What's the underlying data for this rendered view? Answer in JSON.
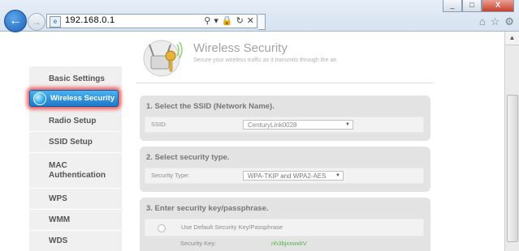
{
  "browser": {
    "url": "192.168.0.1",
    "window_buttons": [
      "_",
      "□",
      "X"
    ]
  },
  "header": {
    "title": "Wireless Security",
    "subtitle": "Secure your wireless traffic as it transmits through the air."
  },
  "sidebar": {
    "items": [
      {
        "label": "Basic Settings"
      },
      {
        "label": "Wireless Security",
        "active": true
      },
      {
        "label": "Radio Setup"
      },
      {
        "label": "SSID Setup"
      },
      {
        "label": "MAC Authentication"
      },
      {
        "label": "WPS"
      },
      {
        "label": "WMM"
      },
      {
        "label": "WDS"
      }
    ]
  },
  "section1": {
    "heading": "1. Select the SSID (Network Name).",
    "ssid_label": "SSID:",
    "ssid_value": "CenturyLink0028"
  },
  "section2": {
    "heading": "2. Select security type.",
    "type_label": "Security Type:",
    "type_value": "WPA-TKIP and WPA2-AES"
  },
  "section3": {
    "heading": "3. Enter security key/passphrase.",
    "default_key_option": "Use Default Security Key/Passphrase",
    "key_label": "Security Key:",
    "key_value": "nh3bjxxwxkV"
  },
  "colors": {
    "active_nav": "#1e78c9",
    "highlight": "#eb2828",
    "key_text": "#57b24a"
  }
}
